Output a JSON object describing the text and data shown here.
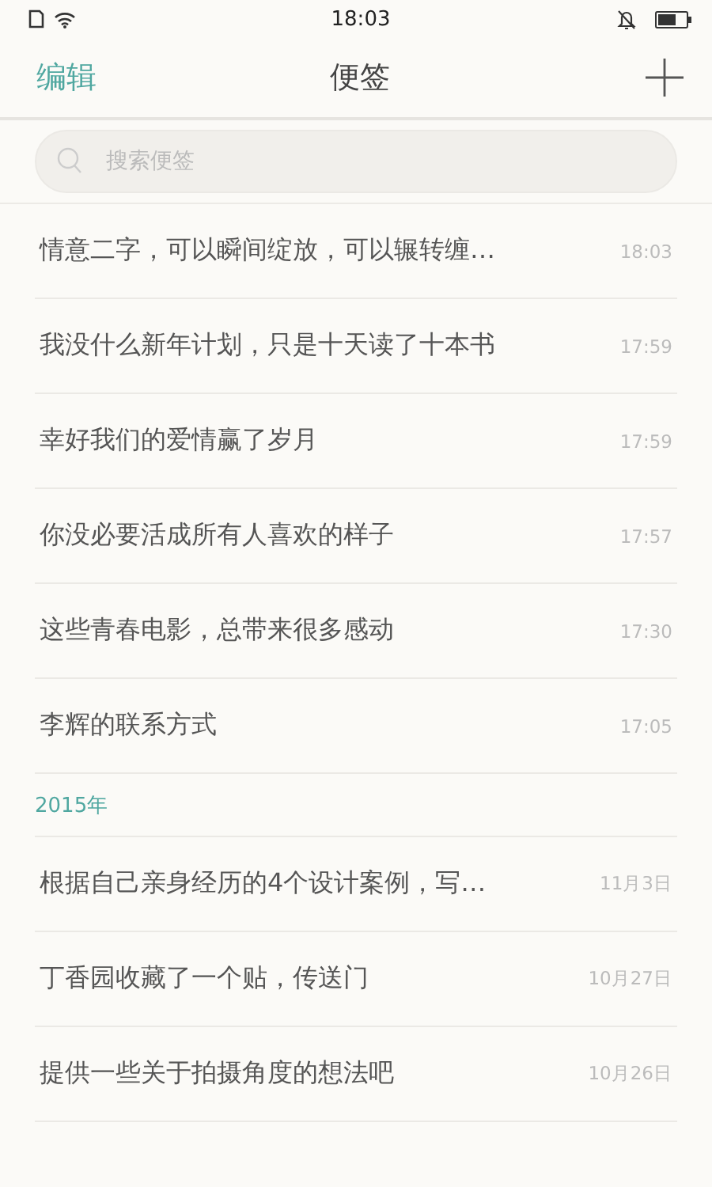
{
  "status_bar": {
    "time": "18:03"
  },
  "header": {
    "edit": "编辑",
    "title": "便签"
  },
  "search": {
    "placeholder": "搜索便签"
  },
  "sections": [
    {
      "notes": [
        {
          "text": "情意二字，可以瞬间绽放，可以辗转缠…",
          "time": "18:03"
        },
        {
          "text": "我没什么新年计划，只是十天读了十本书",
          "time": "17:59"
        },
        {
          "text": "幸好我们的爱情赢了岁月",
          "time": "17:59"
        },
        {
          "text": "你没必要活成所有人喜欢的样子",
          "time": "17:57"
        },
        {
          "text": "这些青春电影，总带来很多感动",
          "time": "17:30"
        },
        {
          "text": "李辉的联系方式",
          "time": "17:05"
        }
      ]
    },
    {
      "heading": "2015年",
      "notes": [
        {
          "text": "根据自己亲身经历的4个设计案例，写…",
          "time": "11月3日"
        },
        {
          "text": "丁香园收藏了一个贴，传送门",
          "time": "10月27日"
        },
        {
          "text": "提供一些关于拍摄角度的想法吧",
          "time": "10月26日"
        }
      ]
    }
  ]
}
